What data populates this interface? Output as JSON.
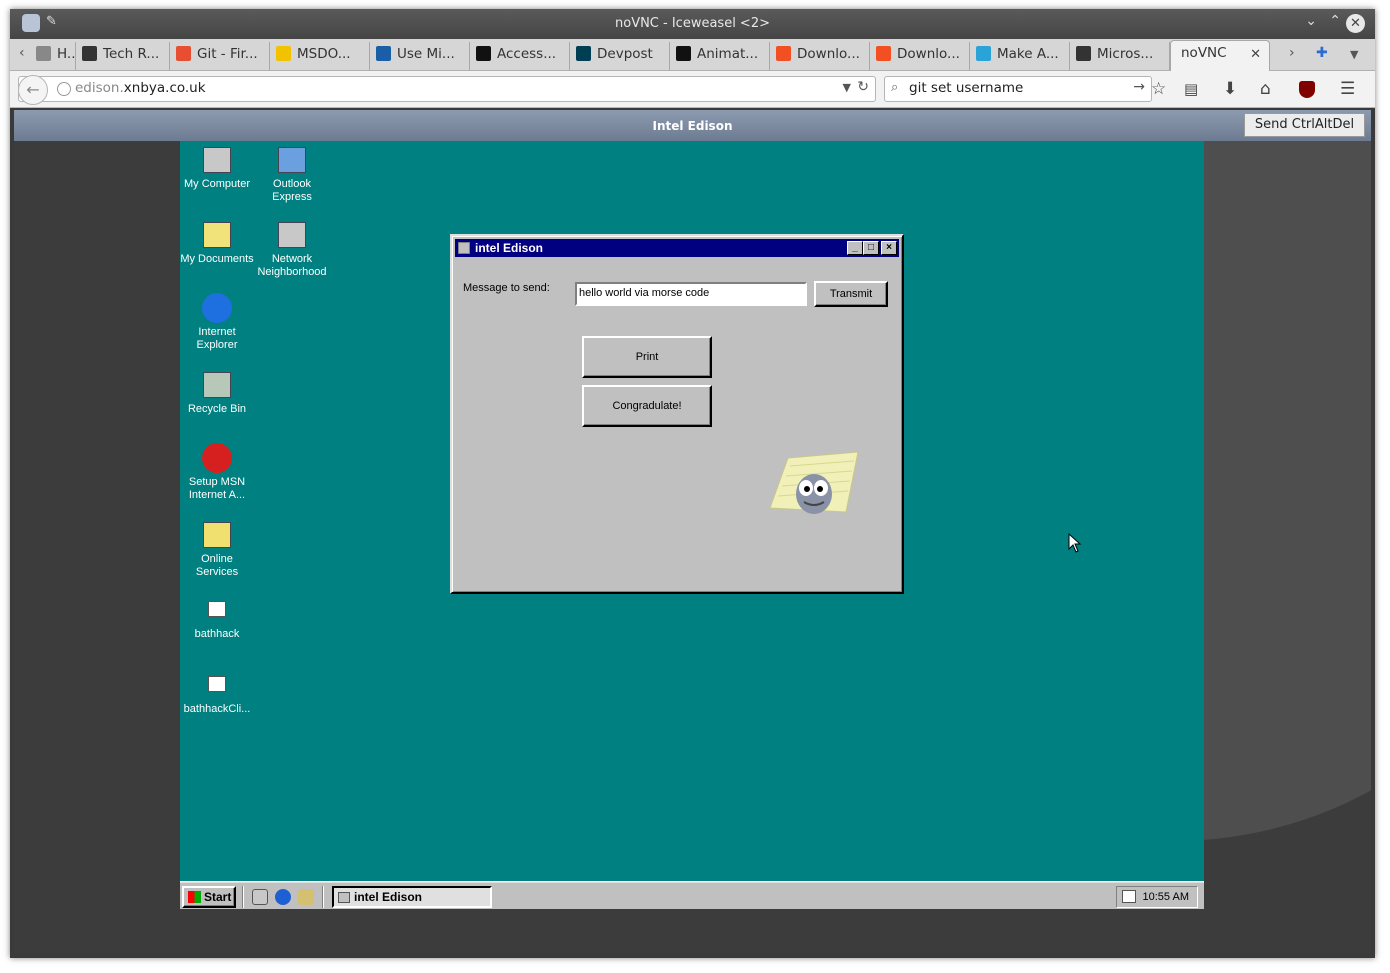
{
  "browser": {
    "window_title": "noVNC - Iceweasel <2>",
    "tabs": [
      {
        "label": "H...",
        "icon": "page-icon",
        "color": "#888888"
      },
      {
        "label": "Tech R...",
        "icon": "techr-icon",
        "color": "#333333"
      },
      {
        "label": "Git - Fir...",
        "icon": "git-icon",
        "color": "#e84e31"
      },
      {
        "label": "MSDO...",
        "icon": "tux-icon",
        "color": "#f2c200"
      },
      {
        "label": "Use Mi...",
        "icon": "vb-icon",
        "color": "#1a5ea8"
      },
      {
        "label": "Access...",
        "icon": "medium-icon",
        "color": "#111111"
      },
      {
        "label": "Devpost",
        "icon": "devpost-icon",
        "color": "#003e54"
      },
      {
        "label": "Animat...",
        "icon": "medium-icon",
        "color": "#111111"
      },
      {
        "label": "Downlo...",
        "icon": "windows-icon",
        "color": "#f25022"
      },
      {
        "label": "Downlo...",
        "icon": "windows-icon",
        "color": "#f25022"
      },
      {
        "label": "Make A...",
        "icon": "m-icon",
        "color": "#2aa3d8"
      },
      {
        "label": "Micros...",
        "icon": "wikipedia-icon",
        "color": "#333333"
      },
      {
        "label": "noVNC",
        "icon": "none",
        "color": "#f2f2f2"
      }
    ],
    "url_host_prefix": "edison.",
    "url_domain": "xnbya.co.uk",
    "search_value": "git set username"
  },
  "novnc": {
    "title": "Intel Edison",
    "ctrlaltdel_label": "Send CtrlAltDel"
  },
  "desktop_icons": [
    {
      "name": "my-computer",
      "label1": "My Computer",
      "label2": ""
    },
    {
      "name": "outlook-express",
      "label1": "Outlook",
      "label2": "Express"
    },
    {
      "name": "my-documents",
      "label1": "My Documents",
      "label2": ""
    },
    {
      "name": "network-neighborhood",
      "label1": "Network",
      "label2": "Neighborhood"
    },
    {
      "name": "internet-explorer",
      "label1": "Internet",
      "label2": "Explorer"
    },
    {
      "name": "recycle-bin",
      "label1": "Recycle Bin",
      "label2": ""
    },
    {
      "name": "setup-msn",
      "label1": "Setup MSN",
      "label2": "Internet A..."
    },
    {
      "name": "online-services",
      "label1": "Online",
      "label2": "Services"
    },
    {
      "name": "bathhack",
      "label1": "bathhack",
      "label2": ""
    },
    {
      "name": "bathhackcli",
      "label1": "bathhackCli...",
      "label2": ""
    }
  ],
  "app_window": {
    "title": "intel Edison",
    "message_label": "Message to send:",
    "message_value": "hello world via morse code",
    "transmit_label": "Transmit",
    "print_label": "Print",
    "congratulate_label": "Congradulate!"
  },
  "taskbar": {
    "start_label": "Start",
    "task_label": "intel Edison",
    "clock": "10:55 AM"
  },
  "colors": {
    "desktop_teal": "#008080",
    "win_titlebar_navy": "#000080",
    "win_face_gray": "#c0c0c0"
  }
}
